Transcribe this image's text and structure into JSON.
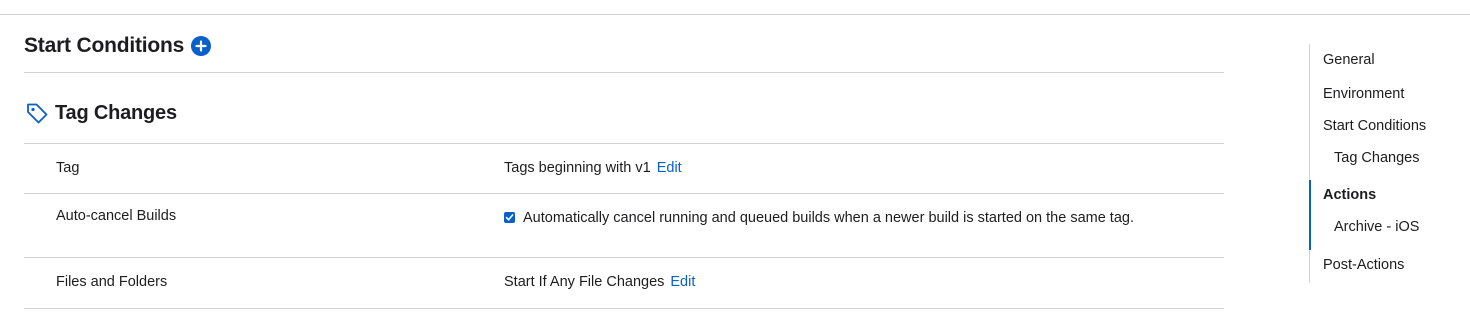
{
  "section": {
    "title": "Start Conditions"
  },
  "subsection": {
    "title": "Tag Changes"
  },
  "rows": [
    {
      "label": "Tag",
      "value": "Tags beginning with v1",
      "link": "Edit"
    },
    {
      "label": "Auto-cancel Builds",
      "checkbox_checked": true,
      "value": "Automatically cancel running and queued builds when a newer build is started on the same tag."
    },
    {
      "label": "Files and Folders",
      "value": "Start If Any File Changes",
      "link": "Edit"
    }
  ],
  "nav": {
    "items": [
      {
        "label": "General"
      },
      {
        "label": "Environment"
      },
      {
        "label": "Start Conditions"
      },
      {
        "label": "Tag Changes"
      },
      {
        "label": "Actions",
        "active": true
      },
      {
        "label": "Archive - iOS"
      },
      {
        "label": "Post-Actions"
      }
    ]
  },
  "colors": {
    "accent": "#0a60c9",
    "divider": "#d2d2d7",
    "text": "#1d1d1f"
  },
  "icons": {
    "add": "plus-circle-icon",
    "tag": "tag-icon",
    "checkbox": "checkmark-icon"
  }
}
